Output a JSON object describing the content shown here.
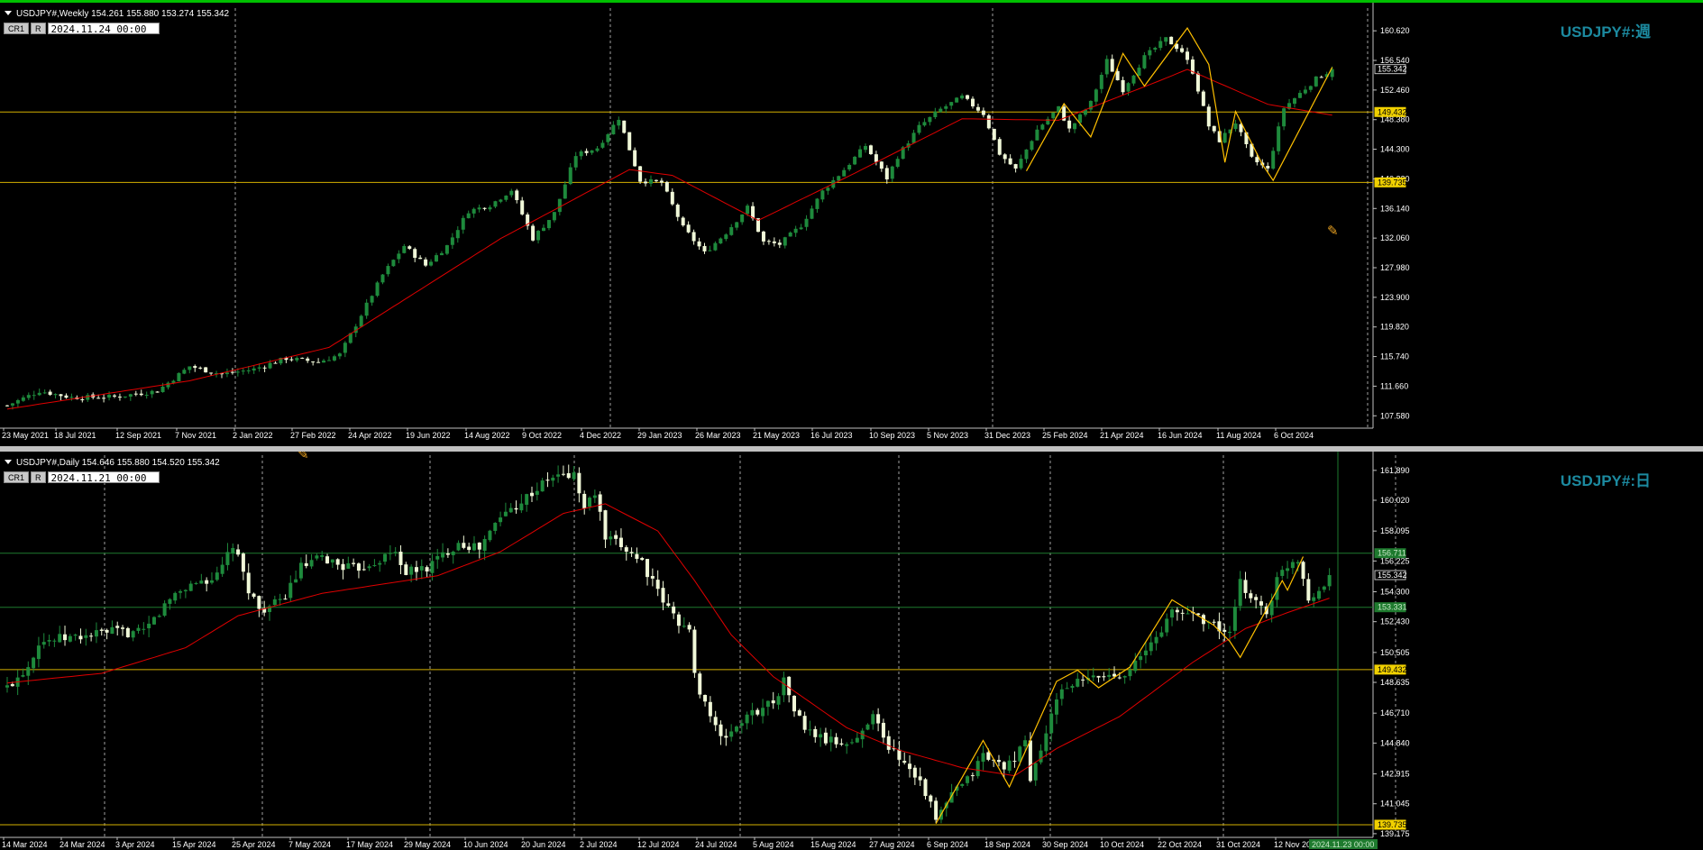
{
  "weekly": {
    "header": "USDJPY#,Weekly  154.261 155.880 153.274 155.342",
    "btn_a": "CR1",
    "btn_b": "R",
    "datetime": "2024.11.24 00:00",
    "title": "USDJPY#:週",
    "price_labels": [
      "160.620",
      "156.540",
      "152.460",
      "148.380",
      "144.300",
      "140.220",
      "136.140",
      "132.060",
      "127.980",
      "123.900",
      "119.820",
      "115.740",
      "111.660",
      "107.580"
    ],
    "tag_current": "155.342",
    "tag_h1": "149.432",
    "tag_h2": "139.735",
    "date_labels": [
      "23 May 2021",
      "18 Jul 2021",
      "12 Sep 2021",
      "7 Nov 2021",
      "2 Jan 2022",
      "27 Feb 2022",
      "24 Apr 2022",
      "19 Jun 2022",
      "14 Aug 2022",
      "9 Oct 2022",
      "4 Dec 2022",
      "29 Jan 2023",
      "26 Mar 2023",
      "21 May 2023",
      "16 Jul 2023",
      "10 Sep 2023",
      "5 Nov 2023",
      "31 Dec 2023",
      "25 Feb 2024",
      "21 Apr 2024",
      "16 Jun 2024",
      "11 Aug 2024",
      "6 Oct 2024"
    ]
  },
  "daily": {
    "header": "USDJPY#,Daily  154.646 155.880 154.520 155.342",
    "btn_a": "CR1",
    "btn_b": "R",
    "datetime": "2024.11.21 00:00",
    "title": "USDJPY#:日",
    "price_labels": [
      "161.890",
      "160.020",
      "158.095",
      "156.225",
      "154.300",
      "152.430",
      "150.505",
      "148.635",
      "146.710",
      "144.840",
      "142.915",
      "141.045",
      "139.175"
    ],
    "tag_current": "155.342",
    "tag_g1": "156.711",
    "tag_g2": "153.331",
    "tag_h1": "149.432",
    "tag_h2": "139.735",
    "cursor_label": "2024.11.23 00:00",
    "date_labels": [
      "14 Mar 2024",
      "24 Mar 2024",
      "3 Apr 2024",
      "15 Apr 2024",
      "25 Apr 2024",
      "7 May 2024",
      "17 May 2024",
      "29 May 2024",
      "10 Jun 2024",
      "20 Jun 2024",
      "2 Jul 2024",
      "12 Jul 2024",
      "24 Jul 2024",
      "5 Aug 2024",
      "15 Aug 2024",
      "27 Aug 2024",
      "6 Sep 2024",
      "18 Sep 2024",
      "30 Sep 2024",
      "10 Oct 2024",
      "22 Oct 2024",
      "31 Oct 2024",
      "12 Nov 2024"
    ]
  },
  "colors": {
    "bull": "#1e8a3c",
    "bear": "#f0f8d8",
    "ma": "#e00000",
    "zigzag": "#ffc000",
    "hline": "#d4b000",
    "greenline": "#1e7a2e",
    "grid": "#a0a0a0",
    "text": "#ffffff",
    "title": "#1c8aa0"
  },
  "chart_data": [
    {
      "type": "candlestick",
      "symbol": "USDJPY#",
      "timeframe": "Weekly",
      "last_bar": {
        "open": 154.261,
        "high": 155.88,
        "low": 153.274,
        "close": 155.342
      },
      "ylim": [
        106.0,
        163.0
      ],
      "horizontal_lines": [
        149.432,
        139.735
      ],
      "path": [
        [
          0,
          109.0
        ],
        [
          6,
          111.0
        ],
        [
          12,
          110.1
        ],
        [
          20,
          110.2
        ],
        [
          28,
          111.0
        ],
        [
          34,
          114.4
        ],
        [
          40,
          113.3
        ],
        [
          46,
          114.0
        ],
        [
          52,
          115.5
        ],
        [
          58,
          115.0
        ],
        [
          62,
          116.0
        ],
        [
          66,
          121.5
        ],
        [
          70,
          127.0
        ],
        [
          74,
          131.0
        ],
        [
          78,
          128.3
        ],
        [
          82,
          131.0
        ],
        [
          86,
          135.8
        ],
        [
          90,
          136.6
        ],
        [
          94,
          138.7
        ],
        [
          98,
          132.0
        ],
        [
          102,
          135.5
        ],
        [
          106,
          143.5
        ],
        [
          110,
          144.5
        ],
        [
          114,
          148.6
        ],
        [
          118,
          140.0
        ],
        [
          122,
          139.7
        ],
        [
          126,
          133.5
        ],
        [
          130,
          130.0
        ],
        [
          134,
          132.8
        ],
        [
          138,
          136.3
        ],
        [
          141,
          131.5
        ],
        [
          144,
          131.2
        ],
        [
          148,
          133.8
        ],
        [
          152,
          138.5
        ],
        [
          156,
          141.5
        ],
        [
          160,
          144.8
        ],
        [
          164,
          140.3
        ],
        [
          166,
          143.3
        ],
        [
          170,
          147.4
        ],
        [
          174,
          149.8
        ],
        [
          178,
          151.5
        ],
        [
          182,
          149.2
        ],
        [
          185,
          143.7
        ],
        [
          188,
          141.5
        ],
        [
          192,
          147.0
        ],
        [
          196,
          150.0
        ],
        [
          198,
          147.0
        ],
        [
          202,
          150.7
        ],
        [
          205,
          156.5
        ],
        [
          208,
          152.5
        ],
        [
          212,
          157.0
        ],
        [
          216,
          159.5
        ],
        [
          219,
          157.8
        ],
        [
          221,
          155.0
        ],
        [
          224,
          147.5
        ],
        [
          226,
          145.5
        ],
        [
          229,
          148.0
        ],
        [
          232,
          143.0
        ],
        [
          235,
          141.5
        ],
        [
          238,
          150.0
        ],
        [
          241,
          152.0
        ],
        [
          244,
          154.0
        ],
        [
          247,
          155.3
        ]
      ],
      "ma_anchors": [
        [
          0,
          108.5
        ],
        [
          34,
          112.4
        ],
        [
          60,
          117.0
        ],
        [
          92,
          132.0
        ],
        [
          116,
          141.5
        ],
        [
          124,
          140.7
        ],
        [
          140,
          134.5
        ],
        [
          158,
          141.0
        ],
        [
          178,
          148.5
        ],
        [
          196,
          148.3
        ],
        [
          214,
          153.5
        ],
        [
          220,
          155.3
        ],
        [
          235,
          150.5
        ],
        [
          247,
          149.0
        ]
      ],
      "zigzag": [
        [
          190,
          141.3
        ],
        [
          197,
          150.6
        ],
        [
          202,
          146.0
        ],
        [
          208,
          157.5
        ],
        [
          212,
          153.0
        ],
        [
          220,
          161.0
        ],
        [
          224,
          156.0
        ],
        [
          227,
          142.5
        ],
        [
          229,
          149.5
        ],
        [
          234,
          142.2
        ],
        [
          236,
          140.0
        ],
        [
          247,
          155.6
        ]
      ]
    },
    {
      "type": "candlestick",
      "symbol": "USDJPY#",
      "timeframe": "Daily",
      "last_bar": {
        "open": 154.646,
        "high": 155.88,
        "low": 154.52,
        "close": 155.342
      },
      "ylim": [
        139.0,
        162.5
      ],
      "horizontal_lines": [
        156.711,
        153.331,
        149.432,
        139.735
      ],
      "path": [
        [
          0,
          148.3
        ],
        [
          4,
          149.7
        ],
        [
          6,
          151.2
        ],
        [
          14,
          151.5
        ],
        [
          20,
          151.8
        ],
        [
          26,
          151.7
        ],
        [
          28,
          152.6
        ],
        [
          32,
          154.2
        ],
        [
          36,
          154.9
        ],
        [
          40,
          155.2
        ],
        [
          43,
          157.2
        ],
        [
          46,
          154.5
        ],
        [
          48,
          153.2
        ],
        [
          52,
          153.6
        ],
        [
          56,
          155.8
        ],
        [
          60,
          156.4
        ],
        [
          66,
          155.7
        ],
        [
          70,
          156.2
        ],
        [
          74,
          156.8
        ],
        [
          76,
          155.5
        ],
        [
          80,
          155.8
        ],
        [
          86,
          157.4
        ],
        [
          90,
          157.0
        ],
        [
          94,
          159.0
        ],
        [
          100,
          160.5
        ],
        [
          104,
          161.5
        ],
        [
          108,
          161.6
        ],
        [
          110,
          159.5
        ],
        [
          112,
          160.5
        ],
        [
          114,
          157.6
        ],
        [
          118,
          157.0
        ],
        [
          121,
          156.2
        ],
        [
          124,
          154.2
        ],
        [
          127,
          152.8
        ],
        [
          130,
          151.8
        ],
        [
          131,
          149.0
        ],
        [
          134,
          146.6
        ],
        [
          136,
          145.0
        ],
        [
          140,
          146.2
        ],
        [
          143,
          146.9
        ],
        [
          146,
          147.5
        ],
        [
          148,
          148.7
        ],
        [
          150,
          147.0
        ],
        [
          152,
          145.7
        ],
        [
          156,
          145.0
        ],
        [
          160,
          144.8
        ],
        [
          162,
          145.0
        ],
        [
          165,
          146.9
        ],
        [
          167,
          145.0
        ],
        [
          170,
          144.0
        ],
        [
          173,
          143.0
        ],
        [
          175,
          141.8
        ],
        [
          177,
          140.0
        ],
        [
          180,
          141.6
        ],
        [
          183,
          142.5
        ],
        [
          186,
          144.1
        ],
        [
          189,
          143.5
        ],
        [
          192,
          143.5
        ],
        [
          194,
          145.2
        ],
        [
          195,
          142.5
        ],
        [
          198,
          145.5
        ],
        [
          201,
          148.3
        ],
        [
          204,
          148.6
        ],
        [
          208,
          149.0
        ],
        [
          212,
          149.1
        ],
        [
          216,
          150.1
        ],
        [
          219,
          151.5
        ],
        [
          222,
          153.0
        ],
        [
          226,
          153.0
        ],
        [
          230,
          152.2
        ],
        [
          233,
          151.6
        ],
        [
          235,
          154.8
        ],
        [
          238,
          153.7
        ],
        [
          240,
          153.0
        ],
        [
          242,
          155.0
        ],
        [
          244,
          156.0
        ],
        [
          246,
          156.4
        ],
        [
          248,
          154.0
        ],
        [
          251,
          154.6
        ],
        [
          252,
          155.3
        ]
      ],
      "ma_anchors": [
        [
          0,
          148.6
        ],
        [
          18,
          149.2
        ],
        [
          34,
          150.8
        ],
        [
          44,
          152.8
        ],
        [
          60,
          154.2
        ],
        [
          82,
          155.3
        ],
        [
          94,
          156.8
        ],
        [
          106,
          159.2
        ],
        [
          114,
          159.8
        ],
        [
          124,
          158.1
        ],
        [
          131,
          155.0
        ],
        [
          138,
          151.6
        ],
        [
          146,
          149.0
        ],
        [
          160,
          145.8
        ],
        [
          170,
          144.4
        ],
        [
          182,
          143.3
        ],
        [
          192,
          142.8
        ],
        [
          200,
          144.5
        ],
        [
          212,
          146.5
        ],
        [
          226,
          149.9
        ],
        [
          236,
          152.0
        ],
        [
          244,
          153.0
        ],
        [
          252,
          153.9
        ]
      ],
      "zigzag": [
        [
          177,
          139.8
        ],
        [
          186,
          145.0
        ],
        [
          191,
          142.1
        ],
        [
          200,
          148.7
        ],
        [
          204,
          149.4
        ],
        [
          208,
          148.3
        ],
        [
          214,
          149.6
        ],
        [
          222,
          153.8
        ],
        [
          227,
          152.8
        ],
        [
          230,
          152.2
        ],
        [
          233,
          151.2
        ],
        [
          235,
          150.2
        ],
        [
          243,
          155.0
        ],
        [
          244,
          154.4
        ],
        [
          247,
          156.5
        ]
      ]
    }
  ]
}
